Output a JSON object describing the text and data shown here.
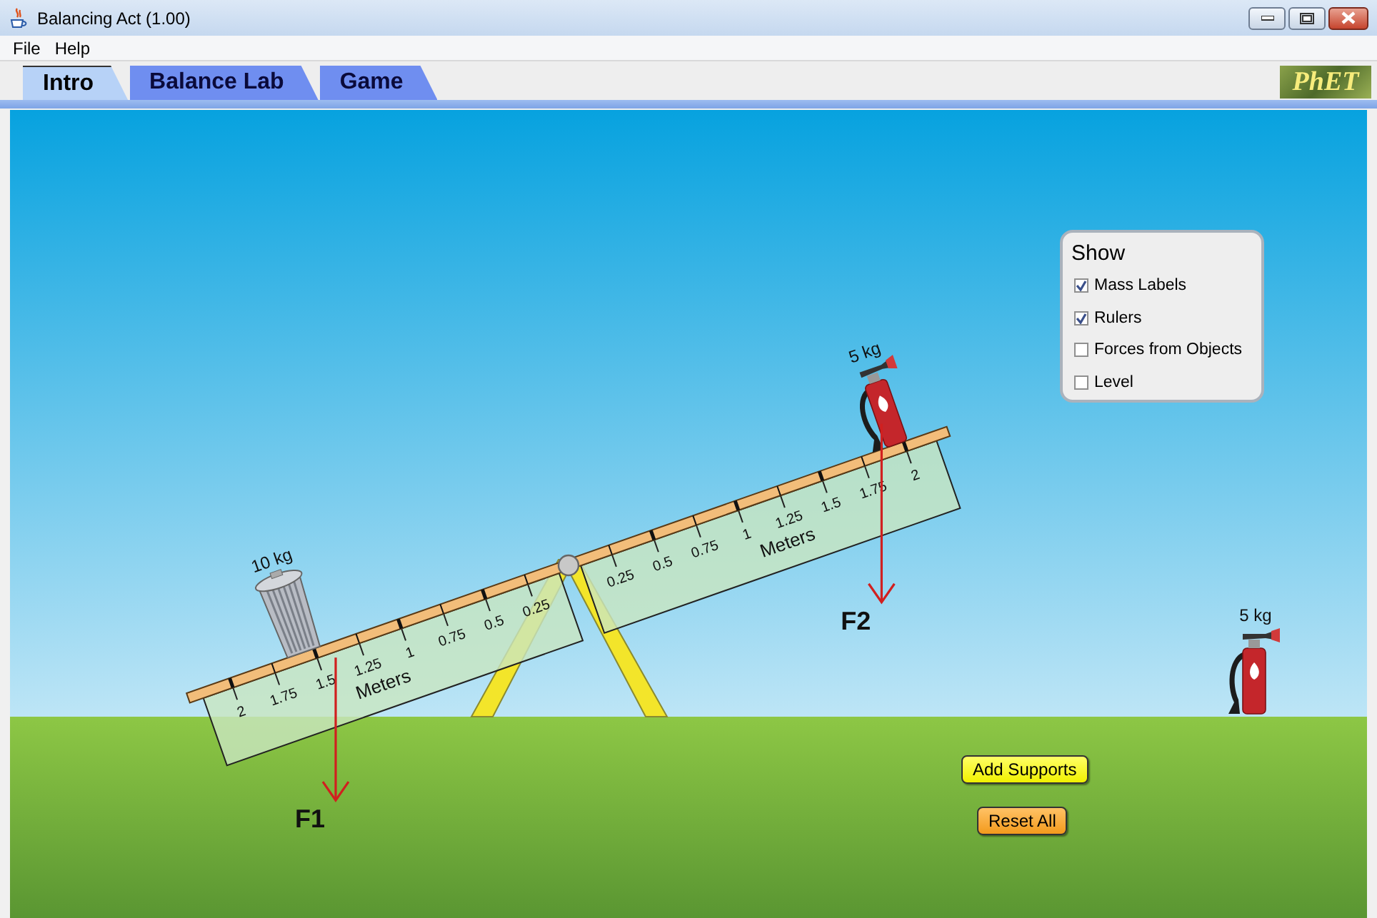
{
  "window": {
    "title": "Balancing Act (1.00)"
  },
  "menu": [
    "File",
    "Help"
  ],
  "tabs": [
    {
      "label": "Intro",
      "selected": true
    },
    {
      "label": "Balance Lab",
      "selected": false
    },
    {
      "label": "Game",
      "selected": false
    }
  ],
  "logo": "PhET",
  "show_panel": {
    "title": "Show",
    "options": [
      {
        "label": "Mass Labels",
        "checked": true
      },
      {
        "label": "Rulers",
        "checked": true
      },
      {
        "label": "Forces from Objects",
        "checked": false
      },
      {
        "label": "Level",
        "checked": false
      }
    ]
  },
  "rulers": [
    {
      "labels": [
        "0.25",
        "0.5",
        "0.75",
        "1",
        "1.25",
        "1.5",
        "1.75",
        "2"
      ],
      "unit": "Meters"
    },
    {
      "labels": [
        "0.25",
        "0.5",
        "0.75",
        "1",
        "1.25",
        "1.5",
        "1.75",
        "2"
      ],
      "unit": "Meters"
    }
  ],
  "plank_objects": [
    {
      "kind": "trash-can",
      "mass_label": "10 kg",
      "force_label": "F1"
    },
    {
      "kind": "fire-extinguisher",
      "mass_label": "5 kg",
      "force_label": "F2"
    }
  ],
  "ground_objects": [
    {
      "kind": "fire-extinguisher",
      "mass_label": "5 kg"
    }
  ],
  "buttons": [
    "Add Supports",
    "Reset All"
  ]
}
